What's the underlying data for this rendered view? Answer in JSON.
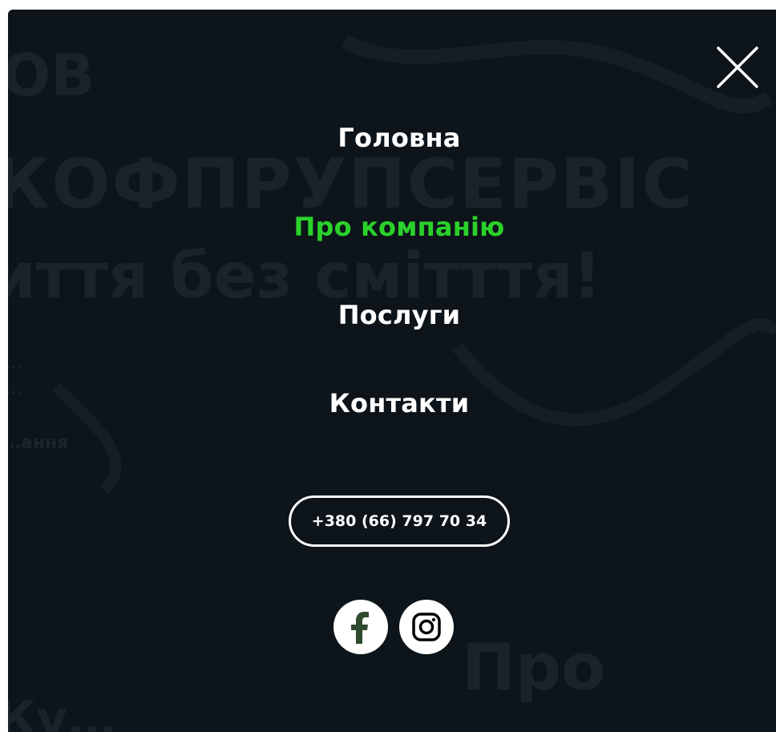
{
  "menu": {
    "items": [
      {
        "label": "Головна",
        "active": false
      },
      {
        "label": "Про компанію",
        "active": true
      },
      {
        "label": "Послуги",
        "active": false
      },
      {
        "label": "Контакти",
        "active": false
      }
    ],
    "phone": "+380 (66) 797 70 34",
    "socials": [
      {
        "icon": "facebook-icon"
      },
      {
        "icon": "instagram-icon"
      }
    ],
    "close_icon": "close-icon"
  },
  "background_page": {
    "headline_line1": "ОВ",
    "headline_line2": "КОФПРУПСЕРВІС",
    "headline_line3": "иття без смітття!",
    "subtitle_line1": "…",
    "subtitle_line2": "…",
    "link": "…ання",
    "section_heading": "Про",
    "footer_fragment": "Ку…"
  },
  "colors": {
    "overlay_bg": "#0d151a",
    "text": "#ffffff",
    "accent": "#2bd12b",
    "facebook_icon": "#2f4a2f"
  }
}
